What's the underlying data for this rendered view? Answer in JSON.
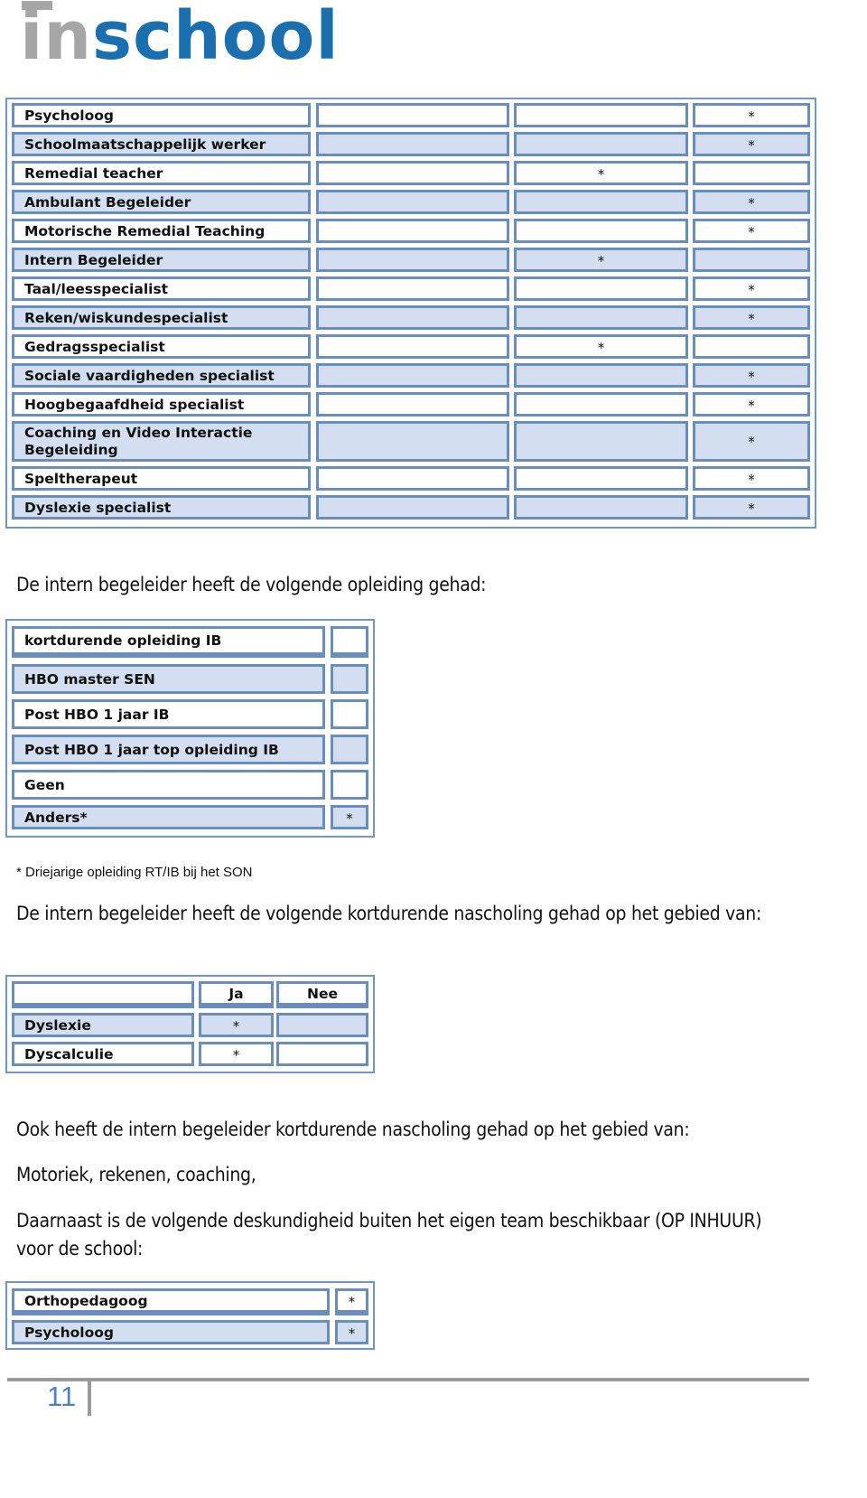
{
  "logo": {
    "part1": "in",
    "part2": "school",
    "colors": {
      "in": "#a6a6a6",
      "school": "#1b6fae"
    }
  },
  "colors": {
    "border": "#6a8dba",
    "row_alt": "#d3dff0",
    "page_number": "#4f81bd"
  },
  "specialists_table": {
    "rows": [
      {
        "label": "Psycholoog",
        "col2": "",
        "col3": "",
        "col4": "*"
      },
      {
        "label": "Schoolmaatschappelijk werker",
        "col2": "",
        "col3": "",
        "col4": "*"
      },
      {
        "label": "Remedial teacher",
        "col2": "",
        "col3": "*",
        "col4": ""
      },
      {
        "label": "Ambulant Begeleider",
        "col2": "",
        "col3": "",
        "col4": "*"
      },
      {
        "label": "Motorische Remedial Teaching",
        "col2": "",
        "col3": "",
        "col4": "*"
      },
      {
        "label": "Intern Begeleider",
        "col2": "",
        "col3": "*",
        "col4": ""
      },
      {
        "label": "Taal/leesspecialist",
        "col2": "",
        "col3": "",
        "col4": "*"
      },
      {
        "label": "Reken/wiskundespecialist",
        "col2": "",
        "col3": "",
        "col4": "*"
      },
      {
        "label": "Gedragsspecialist",
        "col2": "",
        "col3": "*",
        "col4": ""
      },
      {
        "label": "Sociale vaardigheden specialist",
        "col2": "",
        "col3": "",
        "col4": "*"
      },
      {
        "label": "Hoogbegaafdheid specialist",
        "col2": "",
        "col3": "",
        "col4": "*"
      },
      {
        "label": "Coaching en Video Interactie Begeleiding",
        "col2": "",
        "col3": "",
        "col4": "*"
      },
      {
        "label": "Speltherapeut",
        "col2": "",
        "col3": "",
        "col4": "*"
      },
      {
        "label": "Dyslexie specialist",
        "col2": "",
        "col3": "",
        "col4": "*"
      }
    ]
  },
  "heading_training": "De intern begeleider heeft de volgende opleiding gehad:",
  "training_table": {
    "rows": [
      {
        "label": "kortdurende opleiding IB",
        "mark": ""
      },
      {
        "label": "HBO master SEN",
        "mark": ""
      },
      {
        "label": "Post HBO 1 jaar IB",
        "mark": ""
      },
      {
        "label": "Post HBO 1 jaar top opleiding IB",
        "mark": ""
      },
      {
        "label": "Geen",
        "mark": ""
      },
      {
        "label": "Anders*",
        "mark": "*"
      }
    ]
  },
  "footnote": "* Driejarige opleiding RT/IB bij het SON",
  "heading_short_courses": "De intern begeleider heeft de volgende kortdurende nascholing gehad op het gebied van:",
  "short_courses_table": {
    "headers": [
      "",
      "Ja",
      "Nee"
    ],
    "rows": [
      {
        "label": "Dyslexie",
        "ja": "*",
        "nee": ""
      },
      {
        "label": "Dyscalculie",
        "ja": "*",
        "nee": ""
      }
    ]
  },
  "paragraph_also": "Ook heeft de intern begeleider kortdurende nascholing gehad op het gebied van:",
  "paragraph_topics": "Motoriek, rekenen, coaching,",
  "paragraph_external": "Daarnaast is de volgende deskundigheid buiten het eigen team beschikbaar (OP INHUUR) voor de school:",
  "external_table": {
    "rows": [
      {
        "label": "Orthopedagoog",
        "mark": "*"
      },
      {
        "label": "Psycholoog",
        "mark": "*"
      }
    ]
  },
  "footer": {
    "page_number": "11"
  }
}
